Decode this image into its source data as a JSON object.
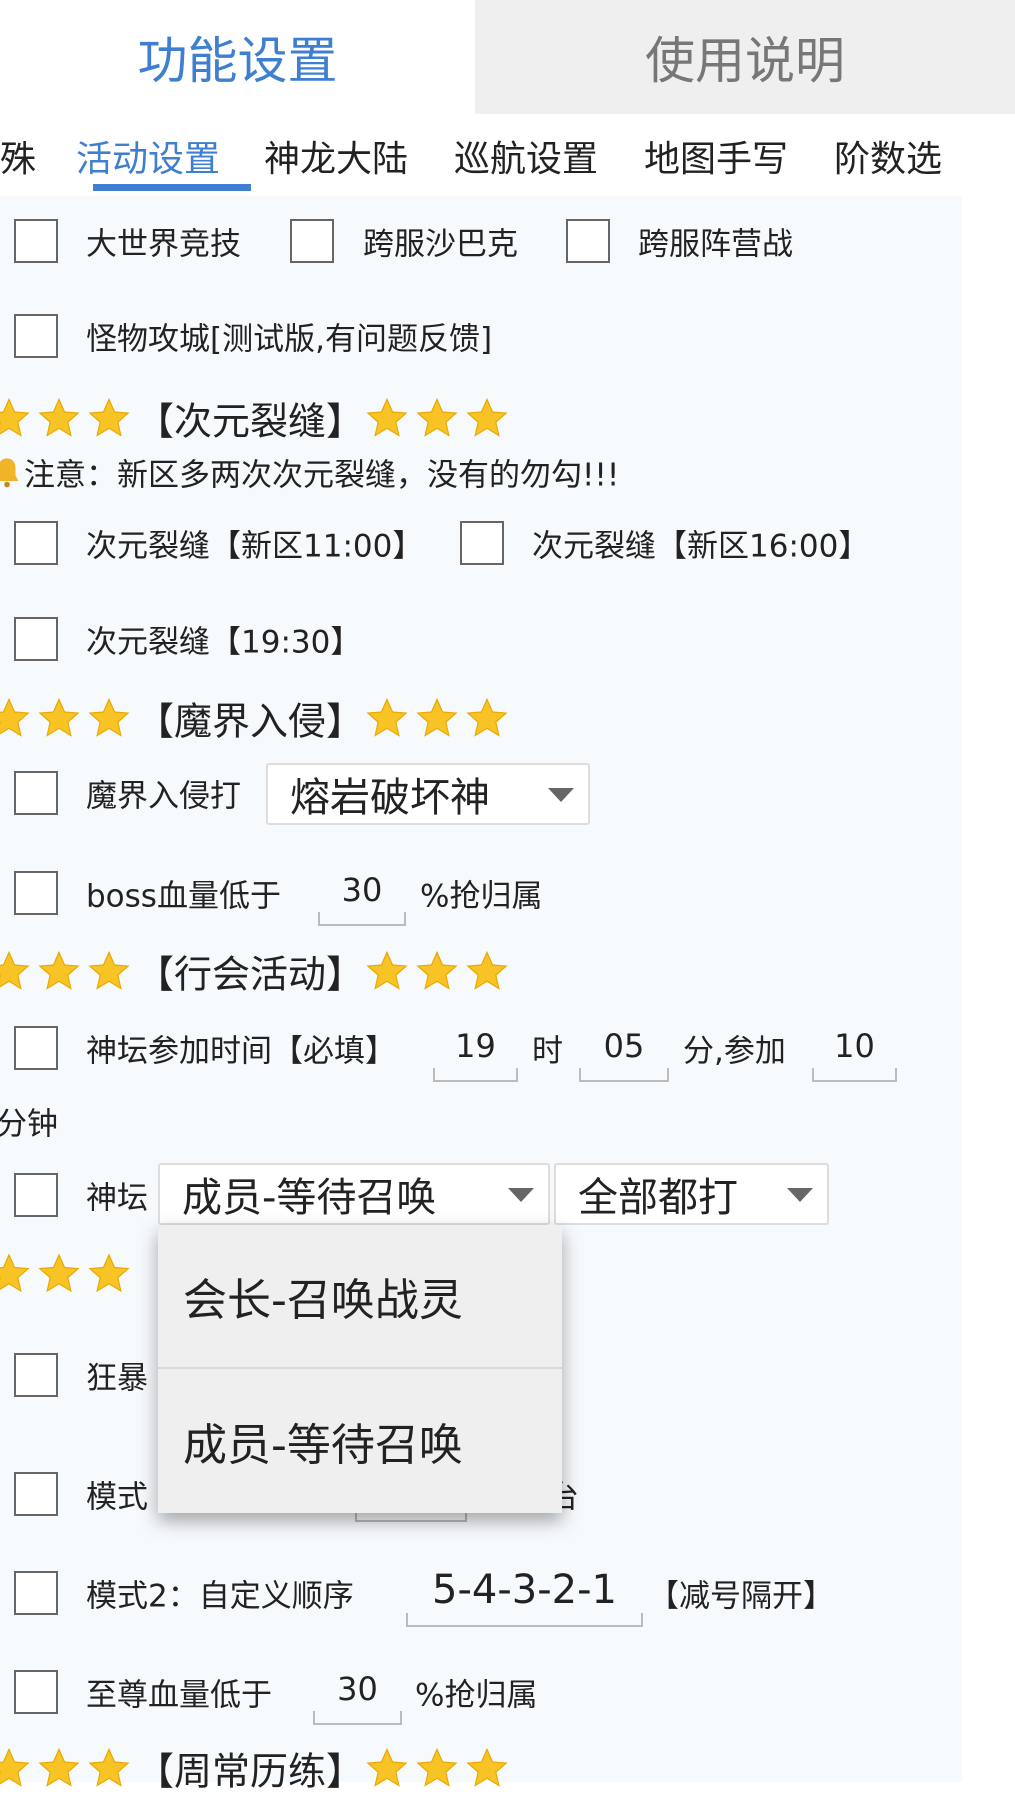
{
  "top_tabs": [
    {
      "label": "功能设置",
      "active": true
    },
    {
      "label": "使用说明",
      "active": false
    }
  ],
  "sub_tabs": [
    {
      "label": "特殊"
    },
    {
      "label": "活动设置",
      "active": true
    },
    {
      "label": "神龙大陆"
    },
    {
      "label": "巡航设置"
    },
    {
      "label": "地图手写"
    },
    {
      "label": "阶数选"
    }
  ],
  "colors": {
    "accent": "#3f7fd0",
    "panel_bg": "#f7fafd",
    "inactive_tab_bg": "#efefef",
    "star": "#f7c325"
  },
  "rows": {
    "world_arena": "大世界竞技",
    "cross_sabak": "跨服沙巴克",
    "cross_camp": "跨服阵营战",
    "monster_siege": "怪物攻城[测试版,有问题反馈]",
    "rift_header": "【次元裂缝】",
    "rift_notice": "注意：新区多两次次元裂缝，没有的勿勾!!!",
    "rift_1100": "次元裂缝【新区11:00】",
    "rift_1600": "次元裂缝【新区16:00】",
    "rift_1930": "次元裂缝【19:30】",
    "demon_header": "【魔界入侵】",
    "demon_fight": "魔界入侵打",
    "demon_select": "熔岩破坏神",
    "boss_hp_label": "boss血量低于",
    "boss_hp_value": "30",
    "boss_hp_suffix": "%抢归属",
    "guild_header": "【行会活动】",
    "altar_time_label": "神坛参加时间【必填】",
    "altar_hour": "19",
    "hour_unit": "时",
    "altar_min": "05",
    "min_unit": "分,参加",
    "altar_duration": "10",
    "duration_unit": "分钟",
    "altar_label": "神坛",
    "altar_role_select": "成员-等待召唤",
    "altar_target_select": "全部都打",
    "berserk_label": "狂暴",
    "mode_label": "模式",
    "mode_tail": "台",
    "mode2_label": "模式2：自定义顺序",
    "mode2_value": "5-4-3-2-1",
    "mode2_hint": "【减号隔开】",
    "supreme_label": "至尊血量低于",
    "supreme_value": "30",
    "supreme_suffix": "%抢归属",
    "weekly_header": "【周常历练】"
  },
  "dropdown_options": [
    "会长-召唤战灵",
    "成员-等待召唤"
  ]
}
